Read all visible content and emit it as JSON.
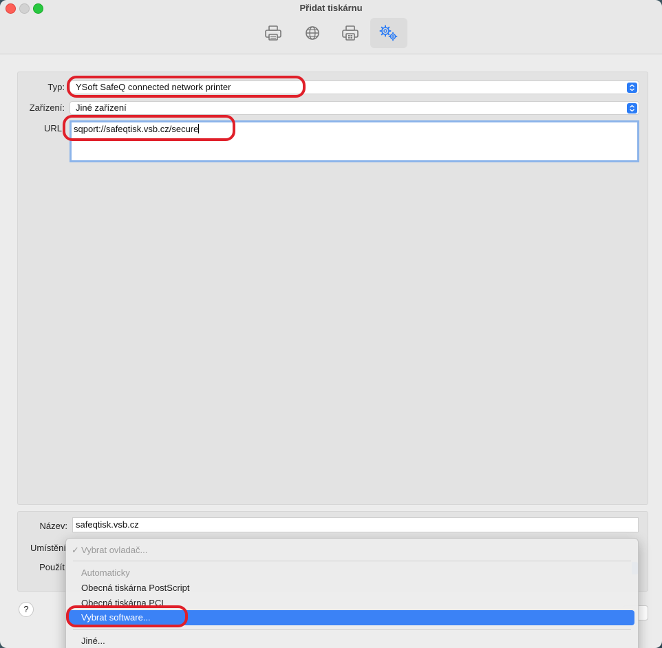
{
  "window": {
    "title": "Přidat tiskárnu"
  },
  "toolbar": {
    "items": [
      {
        "icon": "printer-icon"
      },
      {
        "icon": "globe-icon"
      },
      {
        "icon": "printer-windows-icon"
      },
      {
        "icon": "gears-icon",
        "active": true
      }
    ]
  },
  "form": {
    "type_label": "Typ:",
    "type_value": "YSoft SafeQ connected network printer",
    "device_label": "Zařízení:",
    "device_value": "Jiné zařízení",
    "url_label": "URL",
    "url_value": "sqport://safeqtisk.vsb.cz/secure",
    "name_label": "Název:",
    "name_value": "safeqtisk.vsb.cz",
    "location_label": "Umístění",
    "use_label": "Použít"
  },
  "menu": {
    "checked_item": "Vybrat ovladač...",
    "items": [
      "Automaticky",
      "Obecná tiskárna PostScript",
      "Obecná tiskárna PCL",
      "Vybrat software...",
      "Jiné..."
    ]
  },
  "help": {
    "label": "?"
  },
  "colors": {
    "accent": "#2b7cf6",
    "highlight_annotation": "#e0202a"
  }
}
